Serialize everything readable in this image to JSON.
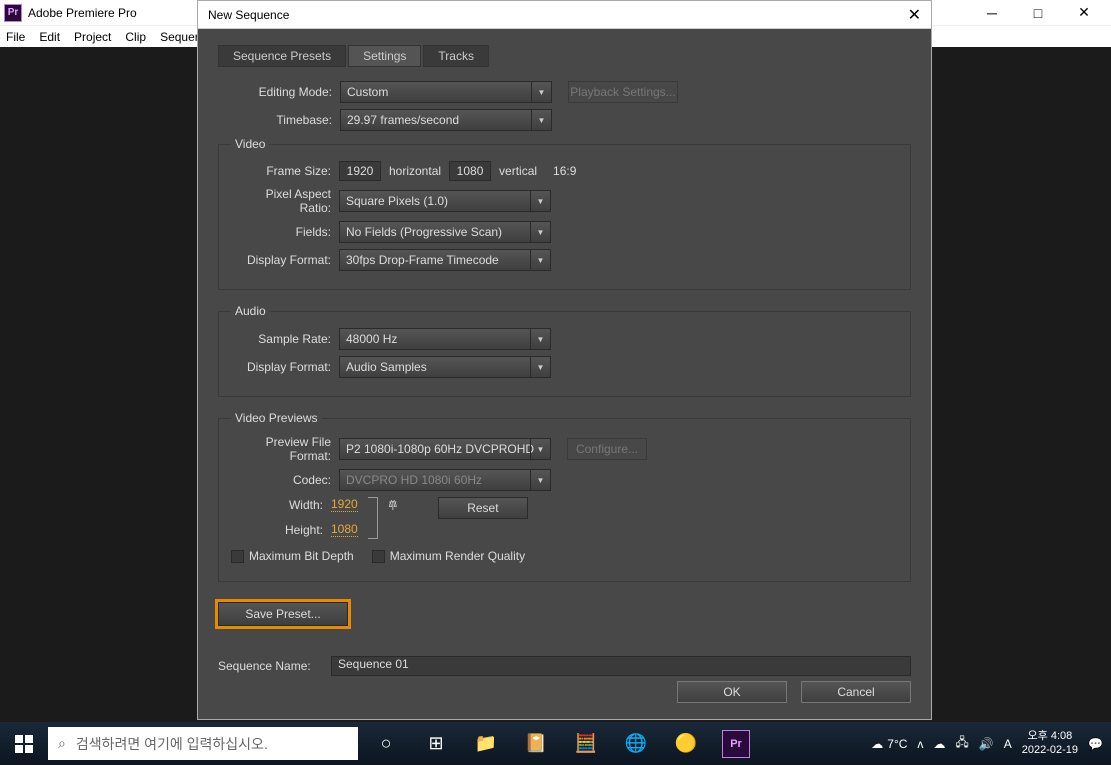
{
  "app": {
    "title": "Adobe Premiere Pro",
    "menus": [
      "File",
      "Edit",
      "Project",
      "Clip",
      "Sequer"
    ]
  },
  "dialog": {
    "title": "New Sequence",
    "tabs": [
      "Sequence Presets",
      "Settings",
      "Tracks"
    ],
    "editing_mode_lbl": "Editing Mode:",
    "editing_mode": "Custom",
    "playback_btn": "Playback Settings...",
    "timebase_lbl": "Timebase:",
    "timebase": "29.97 frames/second",
    "video": {
      "legend": "Video",
      "frame_size_lbl": "Frame Size:",
      "frame_w": "1920",
      "horizontal": "horizontal",
      "frame_h": "1080",
      "vertical": "vertical",
      "ratio": "16:9",
      "par_lbl": "Pixel Aspect Ratio:",
      "par": "Square Pixels (1.0)",
      "fields_lbl": "Fields:",
      "fields": "No Fields (Progressive Scan)",
      "disp_lbl": "Display Format:",
      "disp": "30fps Drop-Frame Timecode"
    },
    "audio": {
      "legend": "Audio",
      "sr_lbl": "Sample Rate:",
      "sr": "48000 Hz",
      "disp_lbl": "Display Format:",
      "disp": "Audio Samples"
    },
    "vprev": {
      "legend": "Video Previews",
      "pff_lbl": "Preview File Format:",
      "pff": "P2 1080i-1080p 60Hz DVCPROHD",
      "configure": "Configure...",
      "codec_lbl": "Codec:",
      "codec": "DVCPRO HD 1080i 60Hz",
      "width_lbl": "Width:",
      "width": "1920",
      "height_lbl": "Height:",
      "height": "1080",
      "reset": "Reset",
      "max_bit": "Maximum Bit Depth",
      "max_render": "Maximum Render Quality"
    },
    "save_preset": "Save Preset...",
    "seq_name_lbl": "Sequence Name:",
    "seq_name": "Sequence 01",
    "ok": "OK",
    "cancel": "Cancel"
  },
  "taskbar": {
    "search_placeholder": "검색하려면 여기에 입력하십시오.",
    "weather": "7°C",
    "lang": "A",
    "time": "오후 4:08",
    "date": "2022-02-19"
  }
}
